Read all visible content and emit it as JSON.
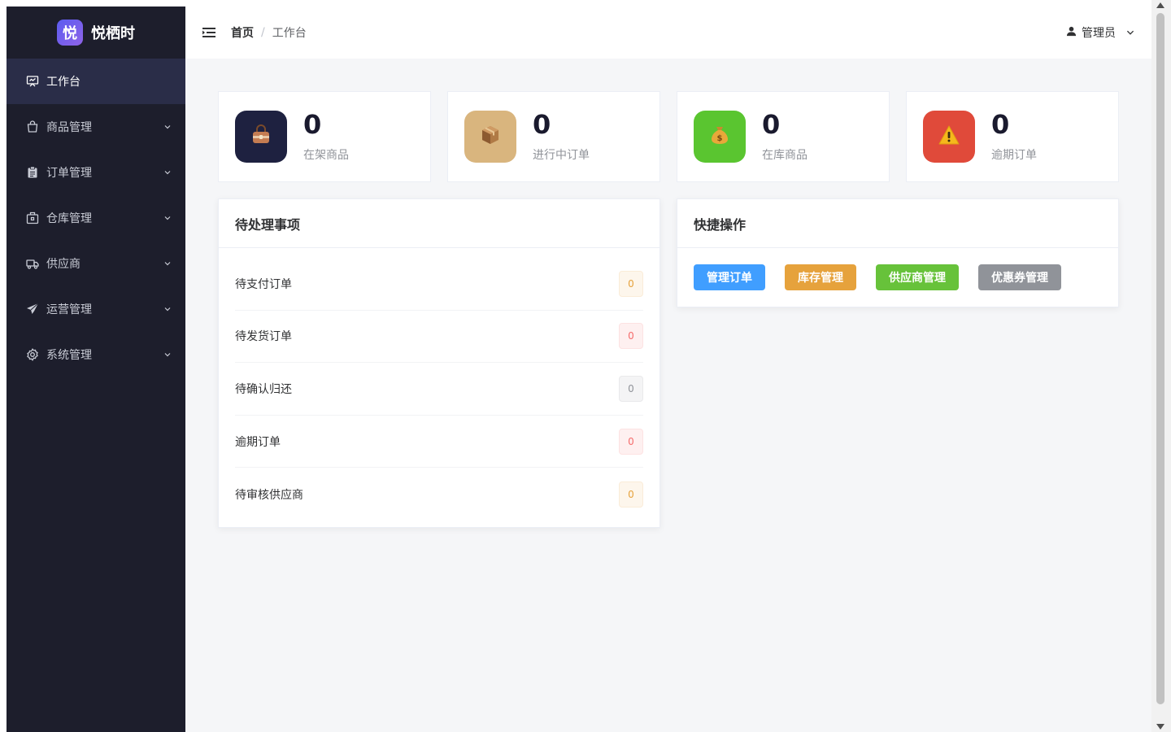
{
  "app": {
    "logo_mark": "悦",
    "logo_text": "悦栖时"
  },
  "sidebar": {
    "items": [
      {
        "label": "工作台",
        "icon": "presentation-board-icon",
        "active": true,
        "expandable": false
      },
      {
        "label": "商品管理",
        "icon": "shopping-bag-icon",
        "active": false,
        "expandable": true
      },
      {
        "label": "订单管理",
        "icon": "clipboard-icon",
        "active": false,
        "expandable": true
      },
      {
        "label": "仓库管理",
        "icon": "warehouse-box-icon",
        "active": false,
        "expandable": true
      },
      {
        "label": "供应商",
        "icon": "truck-icon",
        "active": false,
        "expandable": true
      },
      {
        "label": "运营管理",
        "icon": "paper-plane-icon",
        "active": false,
        "expandable": true
      },
      {
        "label": "系统管理",
        "icon": "gear-icon",
        "active": false,
        "expandable": true
      }
    ]
  },
  "header": {
    "breadcrumb": {
      "home": "首页",
      "separator": "/",
      "current": "工作台"
    },
    "user": {
      "name": "管理员"
    }
  },
  "stats": [
    {
      "value": "0",
      "label": "在架商品",
      "icon": "handbag-icon",
      "bg": "#1e2140"
    },
    {
      "value": "0",
      "label": "进行中订单",
      "icon": "package-icon",
      "bg": "#d9b57e"
    },
    {
      "value": "0",
      "label": "在库商品",
      "icon": "money-bag-icon",
      "bg": "#5ac530"
    },
    {
      "value": "0",
      "label": "逾期订单",
      "icon": "warning-icon",
      "bg": "#e04a3a"
    }
  ],
  "todo": {
    "title": "待处理事项",
    "items": [
      {
        "label": "待支付订单",
        "count": "0",
        "color": "#e6a23c",
        "bg": "#fdf6ec",
        "border": "#faecd8"
      },
      {
        "label": "待发货订单",
        "count": "0",
        "color": "#f56c6c",
        "bg": "#fef0f0",
        "border": "#fde2e2"
      },
      {
        "label": "待确认归还",
        "count": "0",
        "color": "#909399",
        "bg": "#f4f4f5",
        "border": "#e9e9eb"
      },
      {
        "label": "逾期订单",
        "count": "0",
        "color": "#f56c6c",
        "bg": "#fef0f0",
        "border": "#fde2e2"
      },
      {
        "label": "待审核供应商",
        "count": "0",
        "color": "#e6a23c",
        "bg": "#fdf6ec",
        "border": "#faecd8"
      }
    ]
  },
  "quick": {
    "title": "快捷操作",
    "buttons": [
      {
        "label": "管理订单",
        "color": "#409eff"
      },
      {
        "label": "库存管理",
        "color": "#e6a23c"
      },
      {
        "label": "供应商管理",
        "color": "#67c23a"
      },
      {
        "label": "优惠券管理",
        "color": "#909399"
      }
    ]
  }
}
